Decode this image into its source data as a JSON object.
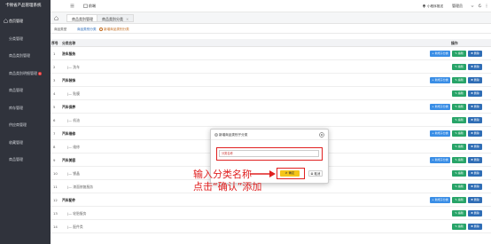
{
  "sidebar": {
    "brand": "卡顿省产品管理系统",
    "items": [
      {
        "label": "首页管理",
        "badge": ""
      },
      {
        "label": "分类管理",
        "badge": ""
      },
      {
        "label": "商品类别管理",
        "badge": ""
      },
      {
        "label": "商品类别明细管理",
        "badge": "1"
      },
      {
        "label": "商品管理",
        "badge": ""
      },
      {
        "label": "库存管理",
        "badge": ""
      },
      {
        "label": "供应商管理",
        "badge": ""
      },
      {
        "label": "收藏管理",
        "badge": ""
      },
      {
        "label": "商品管理",
        "badge": ""
      }
    ]
  },
  "topbar": {
    "external_label": "前端",
    "notification": "小程序推送",
    "user": "管理员"
  },
  "tabs": [
    {
      "label": "商品类别管理"
    },
    {
      "label": "商品类别分类",
      "close": "×"
    }
  ],
  "subbar": {
    "a": "商品类型",
    "b": "商品类别分类",
    "c": "新增商品类别分类"
  },
  "table": {
    "headers": {
      "no": "序号",
      "name": "分类名称",
      "ops": "操作"
    },
    "buttons": {
      "add": "+ 新增子分类",
      "edit": "✎ 编辑",
      "del": "✖ 删除"
    },
    "rows": [
      {
        "no": "1",
        "name": "洗车服务",
        "type": "parent"
      },
      {
        "no": "2",
        "name": "|— 洗车",
        "type": "child"
      },
      {
        "no": "3",
        "name": "汽车装饰",
        "type": "parent"
      },
      {
        "no": "4",
        "name": "|— 贴膜",
        "type": "child"
      },
      {
        "no": "5",
        "name": "汽车保养",
        "type": "parent"
      },
      {
        "no": "6",
        "name": "|— 机油",
        "type": "child"
      },
      {
        "no": "7",
        "name": "汽车维修",
        "type": "parent"
      },
      {
        "no": "8",
        "name": "|— 维修",
        "type": "child"
      },
      {
        "no": "9",
        "name": "汽车美容",
        "type": "parent"
      },
      {
        "no": "10",
        "name": "|— 镀晶",
        "type": "child"
      },
      {
        "no": "11",
        "name": "|— 漆面修复服务",
        "type": "child"
      },
      {
        "no": "12",
        "name": "汽车配件",
        "type": "parent"
      },
      {
        "no": "13",
        "name": "|— 轮胎服务",
        "type": "child"
      },
      {
        "no": "14",
        "name": "|— 配件类",
        "type": "child"
      }
    ]
  },
  "modal": {
    "title": "新增商品类别子分类",
    "placeholder": "分类名称",
    "ok": "确定",
    "cancel": "取消"
  },
  "annotation": {
    "line1": "输入分类名称",
    "line2": "点击“确认”添加"
  },
  "colors": {
    "sidebar_bg": "#30333c",
    "add_btn": "#3a8ee6",
    "edit_btn": "#27a468",
    "del_btn": "#2f6db5",
    "highlight": "#e02020",
    "ok_btn": "#f5c518"
  }
}
